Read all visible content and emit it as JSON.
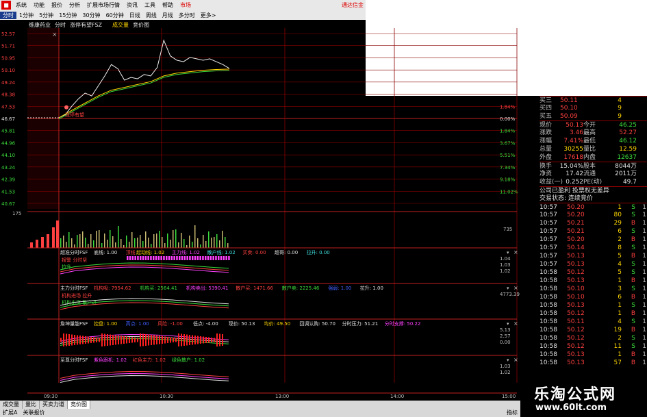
{
  "menu": {
    "logo": "",
    "items": [
      "系统",
      "功能",
      "报价",
      "分析",
      "扩展市场行情",
      "资讯",
      "工具",
      "帮助"
    ],
    "active": "市场",
    "right": "通达信金"
  },
  "periods": {
    "items": [
      "分时",
      "1分钟",
      "5分钟",
      "15分钟",
      "30分钟",
      "60分钟",
      "日线",
      "周线",
      "月线",
      "多分时",
      "更多>"
    ],
    "active_index": 0
  },
  "main_chart": {
    "title_items": [
      "维康药业",
      "分时",
      "涨停有望FSZ",
      "成交量",
      "竞价图"
    ],
    "y_left": [
      "52.57",
      "51.71",
      "50.95",
      "50.10",
      "49.24",
      "48.38",
      "47.53",
      "46.67",
      "45.81",
      "44.96",
      "44.10",
      "43.24",
      "42.39",
      "41.53",
      "40.67"
    ],
    "y_right": [
      "1.84%",
      "0.00%",
      "1.84%",
      "3.67%",
      "5.51%",
      "7.34%",
      "9.18%",
      "11.02%"
    ],
    "annotation": "涨停有望",
    "close_icon": "×"
  },
  "chart_data": [
    {
      "type": "line",
      "title": "",
      "series": [
        {
          "name": "price",
          "x_minutes": [
            0,
            10,
            20,
            30,
            40,
            50,
            60,
            70,
            80,
            90,
            100,
            110,
            120,
            130,
            140,
            150,
            160,
            170,
            180,
            190,
            200,
            210,
            220,
            230,
            240,
            250,
            260
          ],
          "values": [
            46.67,
            46.9,
            47.5,
            48.0,
            48.4,
            48.2,
            48.9,
            49.6,
            50.4,
            50.1,
            49.3,
            49.5,
            49.4,
            49.7,
            49.6,
            50.2,
            52.1,
            51.0,
            50.7,
            50.6,
            50.9,
            50.8,
            50.7,
            50.8,
            50.6,
            50.4,
            50.13
          ]
        },
        {
          "name": "avg",
          "x_minutes": [
            0,
            20,
            40,
            60,
            80,
            100,
            120,
            140,
            160,
            180,
            200,
            220,
            240,
            260
          ],
          "values": [
            46.67,
            47.2,
            47.7,
            48.2,
            48.6,
            48.8,
            49.0,
            49.2,
            49.6,
            49.8,
            49.9,
            50.0,
            50.05,
            50.08
          ]
        }
      ],
      "ylim": [
        40.67,
        52.57
      ]
    },
    {
      "type": "bar",
      "title": "",
      "y_left": [
        "175"
      ],
      "y_right": [
        "735"
      ]
    }
  ],
  "indicators": [
    {
      "name": "超准分时FSF",
      "items": [
        {
          "t": "底线: 1.00",
          "c": "#e0e0e0"
        },
        {
          "t": "顶线",
          "c": "#ff4040"
        },
        {
          "t": "起动线: 1.02",
          "c": "#ffd700"
        },
        {
          "t": "主力线: 1.02",
          "c": "#ff40ff"
        },
        {
          "t": "散户线: 1.02",
          "c": "#40e0e0"
        },
        {
          "t": "买卖: 0.00",
          "c": "#ff4040"
        },
        {
          "t": "超哥: 0.00",
          "c": "#e0e0e0"
        },
        {
          "t": "拉升: 0.00",
          "c": "#40e0e0"
        }
      ],
      "y_right": [
        "1.04",
        "1.03",
        "1.02"
      ],
      "labels": [
        "报警 分时坚",
        "拉升"
      ]
    },
    {
      "name": "主力分时FSF",
      "items": [
        {
          "t": "机构吸: 7954.62",
          "c": "#ff4040"
        },
        {
          "t": "机构买: 2564.41",
          "c": "#3cdc3c"
        },
        {
          "t": "机构卖出: 5390.41",
          "c": "#ff40ff"
        },
        {
          "t": "散户买: 1471.66",
          "c": "#ff4040"
        },
        {
          "t": "散户卖: 2225.46",
          "c": "#3cdc3c"
        },
        {
          "t": "强弱: 1.00",
          "c": "#4060ff"
        },
        {
          "t": "拉升: 1.00",
          "c": "#e0e0e0"
        }
      ],
      "y_right": [
        "4773.39"
      ],
      "labels": [
        "机构进场 拉升",
        "机构出货 散户进"
      ]
    },
    {
      "name": "詹坤量能FSF",
      "items": [
        {
          "t": "控盘: 1.00",
          "c": "#ffd700"
        },
        {
          "t": "高点: 1.00",
          "c": "#4060ff"
        },
        {
          "t": "风险: -1.00",
          "c": "#ff4040"
        },
        {
          "t": "低点: -4.00",
          "c": "#e0e0e0"
        },
        {
          "t": "现价: 50.13",
          "c": "#e0e0e0"
        },
        {
          "t": "均价: 49.50",
          "c": "#ffd700"
        },
        {
          "t": "回调认购: 50.70",
          "c": "#e0e0e0"
        },
        {
          "t": "分时压力: 51.21",
          "c": "#e0e0e0"
        },
        {
          "t": "分时支撑: 50.22",
          "c": "#ff40ff"
        }
      ],
      "y_right": [
        "5.13",
        "2.57",
        "0.00"
      ],
      "labels": []
    },
    {
      "name": "至尊分时FSF",
      "items": [
        {
          "t": "紫色跟机: 1.02",
          "c": "#ff40ff"
        },
        {
          "t": "红色主力: 1.02",
          "c": "#ff4040"
        },
        {
          "t": "绿色散户: 1.02",
          "c": "#3cdc3c"
        }
      ],
      "y_right": [
        "1.03",
        "1.02"
      ],
      "labels": []
    }
  ],
  "time_axis": [
    "09:30",
    "10:30",
    "13:00",
    "14:00",
    "15:00"
  ],
  "quote": {
    "bids": [
      {
        "label": "买三",
        "price": "50.11",
        "vol": "4"
      },
      {
        "label": "买四",
        "price": "50.10",
        "vol": "9"
      },
      {
        "label": "买五",
        "price": "50.09",
        "vol": "9"
      }
    ],
    "stats": [
      [
        {
          "t": "现价",
          "c": "lbl"
        },
        {
          "t": "50.13",
          "c": "red"
        },
        {
          "t": "今开",
          "c": "lbl"
        },
        {
          "t": "46.25",
          "c": "green"
        }
      ],
      [
        {
          "t": "涨跌",
          "c": "lbl"
        },
        {
          "t": "3.46",
          "c": "red"
        },
        {
          "t": "最高",
          "c": "lbl"
        },
        {
          "t": "52.27",
          "c": "red"
        }
      ],
      [
        {
          "t": "涨幅",
          "c": "lbl"
        },
        {
          "t": "7.41%",
          "c": "red"
        },
        {
          "t": "最低",
          "c": "lbl"
        },
        {
          "t": "46.12",
          "c": "green"
        }
      ],
      [
        {
          "t": "总量",
          "c": "lbl"
        },
        {
          "t": "30255",
          "c": "yel"
        },
        {
          "t": "量比",
          "c": "lbl"
        },
        {
          "t": "12.59",
          "c": "yel"
        }
      ],
      [
        {
          "t": "外盘",
          "c": "lbl"
        },
        {
          "t": "17618",
          "c": "red"
        },
        {
          "t": "内盘",
          "c": "lbl"
        },
        {
          "t": "12637",
          "c": "green"
        }
      ]
    ],
    "stats2": [
      [
        {
          "t": "换手",
          "c": "lbl"
        },
        {
          "t": "15.04%",
          "c": "wht"
        },
        {
          "t": "股本",
          "c": "lbl"
        },
        {
          "t": "8044万",
          "c": "wht"
        }
      ],
      [
        {
          "t": "净资",
          "c": "lbl"
        },
        {
          "t": "17.42",
          "c": "wht"
        },
        {
          "t": "流通",
          "c": "lbl"
        },
        {
          "t": "2011万",
          "c": "wht"
        }
      ],
      [
        {
          "t": "收益(一)",
          "c": "lbl"
        },
        {
          "t": "0.252",
          "c": "wht"
        },
        {
          "t": "PE(动)",
          "c": "lbl"
        },
        {
          "t": "49.7",
          "c": "wht"
        }
      ]
    ],
    "info1": "公司已盈利 投票权无差异",
    "info2": "交易状态: 连续竞价",
    "ticks": [
      [
        "10:57",
        "50.20",
        "1",
        "S"
      ],
      [
        "10:57",
        "50.20",
        "80",
        "S"
      ],
      [
        "10:57",
        "50.21",
        "29",
        "B"
      ],
      [
        "10:57",
        "50.21",
        "6",
        "S"
      ],
      [
        "10:57",
        "50.20",
        "2",
        "B"
      ],
      [
        "10:57",
        "50.14",
        "8",
        "S"
      ],
      [
        "10:57",
        "50.13",
        "5",
        "B"
      ],
      [
        "10:57",
        "50.13",
        "4",
        "S"
      ],
      [
        "10:58",
        "50.12",
        "5",
        "S"
      ],
      [
        "10:58",
        "50.13",
        "1",
        "B"
      ],
      [
        "10:58",
        "50.10",
        "3",
        "S"
      ],
      [
        "10:58",
        "50.10",
        "6",
        "B"
      ],
      [
        "10:58",
        "50.13",
        "1",
        "S"
      ],
      [
        "10:58",
        "50.12",
        "1",
        "B"
      ],
      [
        "10:58",
        "50.11",
        "4",
        "S"
      ],
      [
        "10:58",
        "50.12",
        "19",
        "B"
      ],
      [
        "10:58",
        "50.12",
        "2",
        "S"
      ],
      [
        "10:58",
        "50.12",
        "11",
        "S"
      ],
      [
        "10:58",
        "50.13",
        "1",
        "B"
      ],
      [
        "10:58",
        "50.13",
        "57",
        "B"
      ]
    ]
  },
  "bottom_tabs": [
    "成交量",
    "量比",
    "买卖力道",
    "竞价图"
  ],
  "bottom_active": 3,
  "status": [
    "扩展A",
    "关联报价"
  ],
  "status_right": "指标",
  "watermark": {
    "cn": "乐淘公式网",
    "url": "www.60lt.com"
  }
}
